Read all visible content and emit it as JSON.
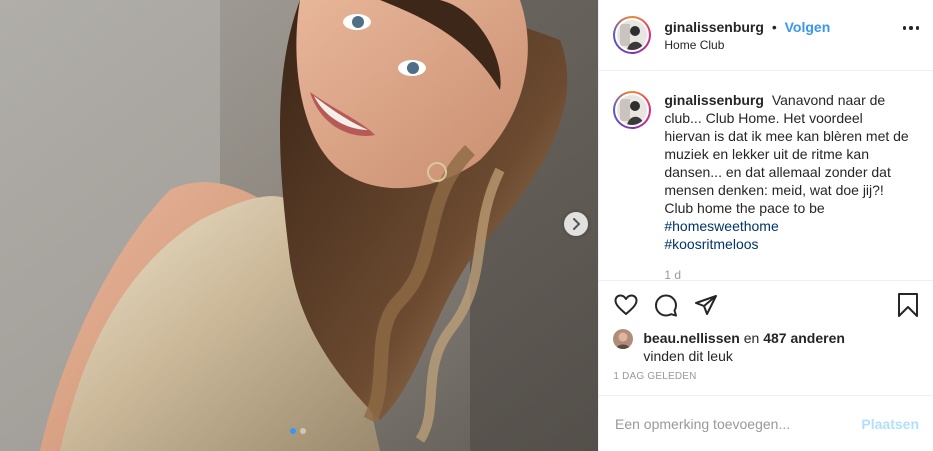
{
  "post": {
    "username": "ginalissenburg",
    "separator": "•",
    "follow_label": "Volgen",
    "location": "Home Club",
    "more_icon": "more-horizontal-icon",
    "caption": {
      "username": "ginalissenburg",
      "text": "Vanavond naar de club... Club Home. Het voordeel hiervan is dat ik mee kan blèren met de muziek en lekker uit de ritme kan dansen... en dat allemaal zonder dat mensen denken: meid, wat doe jij?! Club home the pace to be",
      "hashtags": [
        "#homesweethome",
        "#koosritmeloos"
      ],
      "time_ago": "1 d"
    },
    "likes": {
      "liker": "beau.nellissen",
      "connector": "en",
      "count_text": "487 anderen",
      "suffix": "vinden dit leuk"
    },
    "date": "1 DAG GELEDEN",
    "comment": {
      "placeholder": "Een opmerking toevoegen...",
      "submit_label": "Plaatsen"
    },
    "carousel": {
      "current": 1,
      "total": 2
    },
    "colors": {
      "accent": "#3897f0",
      "hashtag": "#003569",
      "post_disabled": "#b2dffc"
    }
  }
}
